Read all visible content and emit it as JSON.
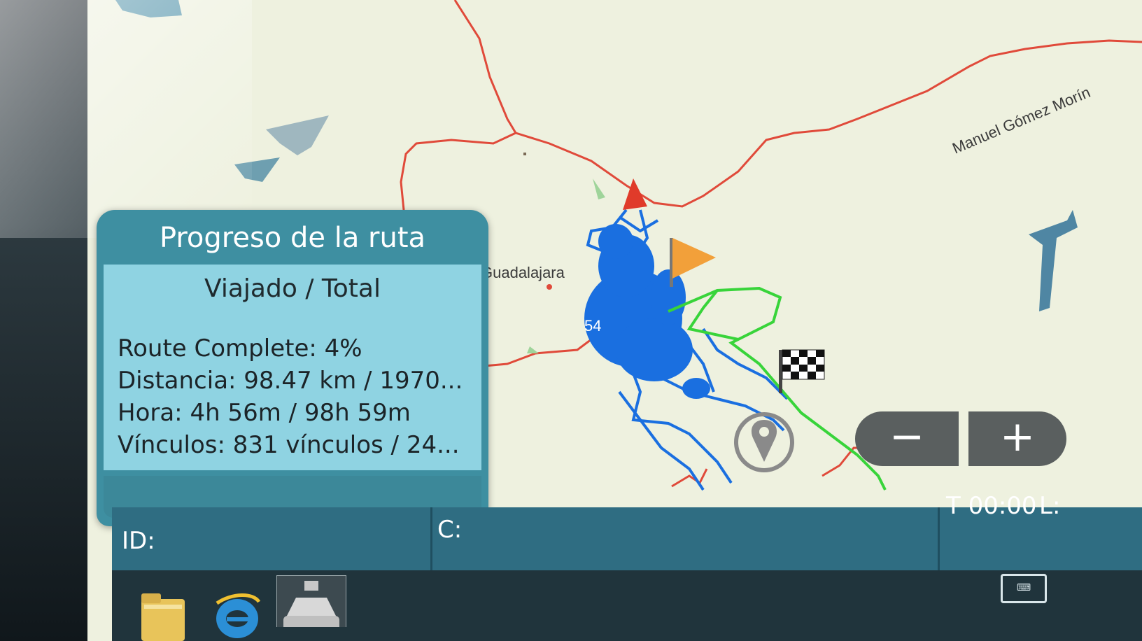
{
  "map": {
    "city_label": "Guadalajara",
    "road_label": "Manuel Gómez Morín",
    "route_marker_number": "54"
  },
  "panel": {
    "title": "Progreso de la ruta",
    "subtitle": "Viajado / Total",
    "route_complete": "Route Complete: 4%",
    "distance": "Distancia: 98.47 km / 1970...",
    "time": "Hora: 4h 56m / 98h 59m",
    "links": "Vínculos: 831 vínculos / 24..."
  },
  "zoom": {
    "minus": "−",
    "plus": "+"
  },
  "statusbar": {
    "id_label": "ID:",
    "c_label": "C:",
    "time_label": "T 00:00",
    "l_label": "L:"
  },
  "icons": [
    "folder-icon",
    "internet-explorer-icon",
    "vehicle-app-icon",
    "keyboard-icon",
    "start-flag-icon",
    "finish-flag-icon",
    "location-pin-icon",
    "direction-arrow-icon"
  ],
  "colors": {
    "road": "#e04a3a",
    "route_explored": "#1a6fe0",
    "route_planned": "#38d43a",
    "panel_header": "#3e8fa1",
    "panel_body": "#8fd3e2",
    "statusbar": "#2f6d82"
  }
}
